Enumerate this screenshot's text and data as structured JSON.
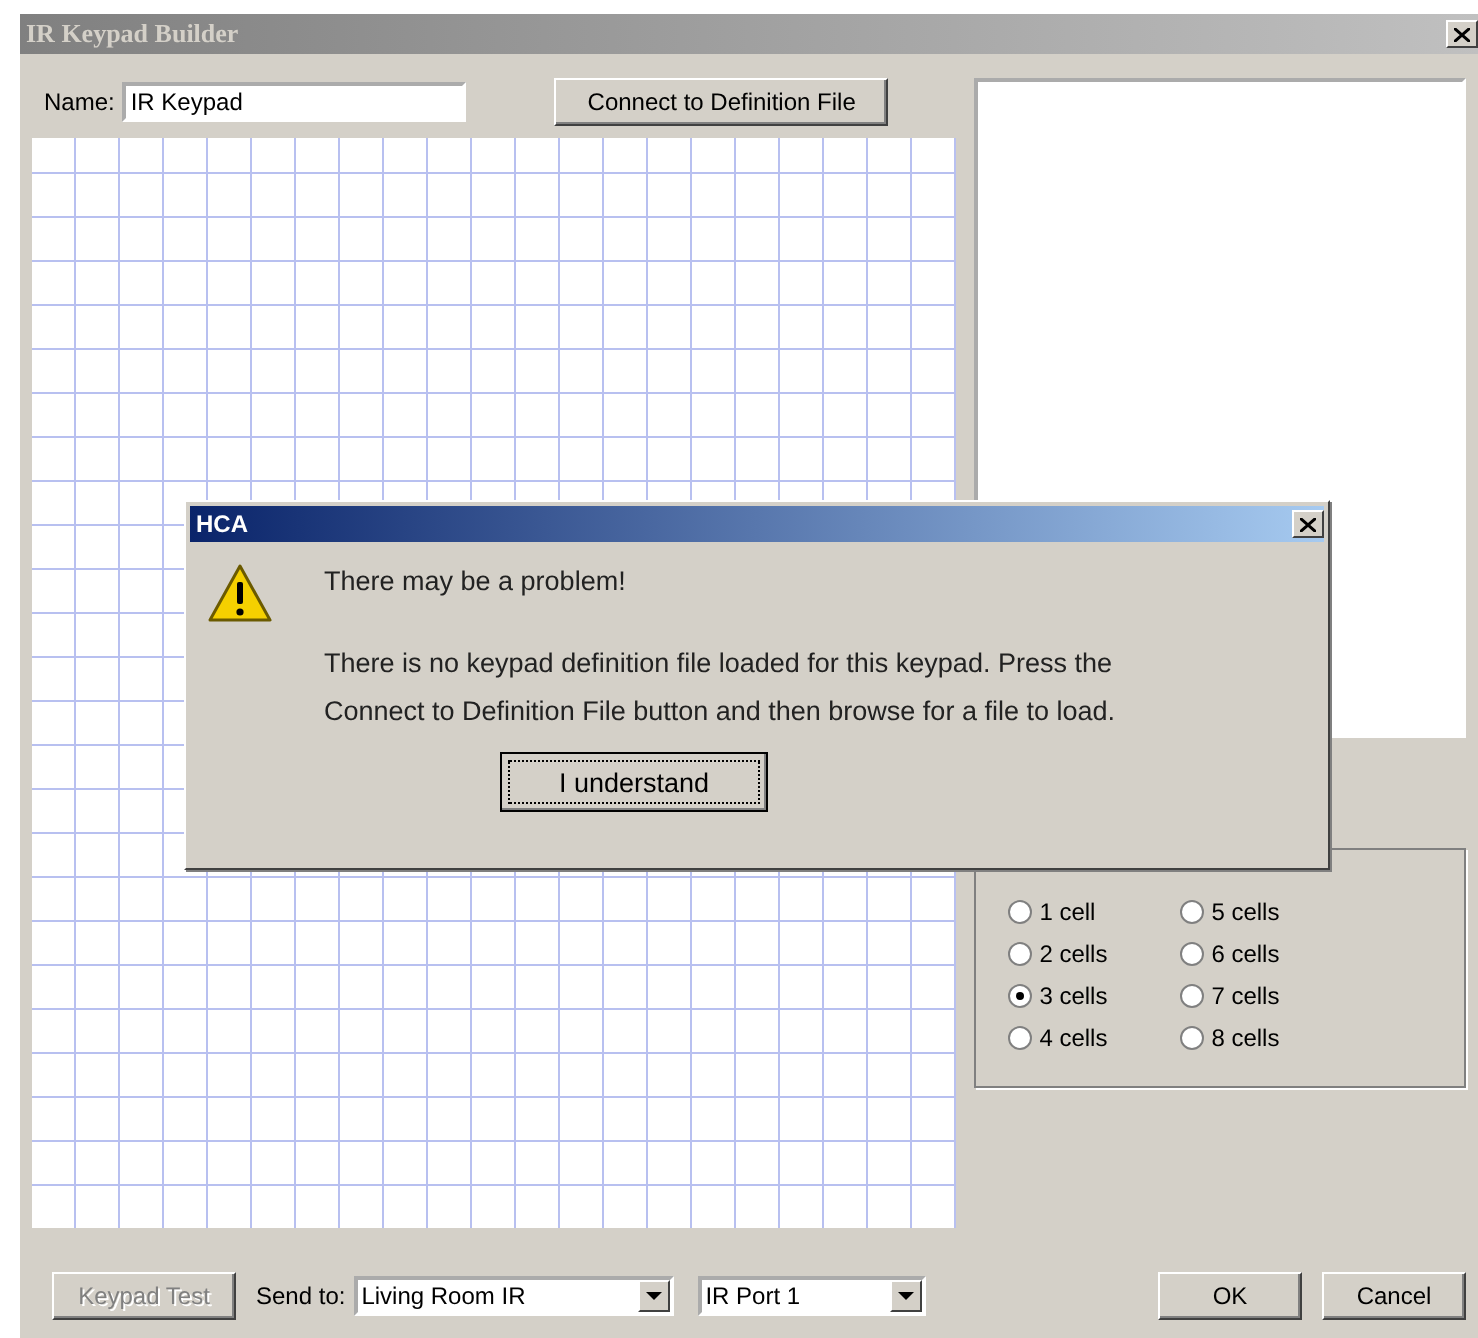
{
  "window": {
    "title": "IR Keypad Builder"
  },
  "name_field": {
    "label": "Name:",
    "value": "IR Keypad"
  },
  "connect_button": {
    "label": "Connect to Definition File"
  },
  "cell_options": [
    {
      "label": "1 cell",
      "selected": false
    },
    {
      "label": "2 cells",
      "selected": false
    },
    {
      "label": "3 cells",
      "selected": true
    },
    {
      "label": "4 cells",
      "selected": false
    },
    {
      "label": "5 cells",
      "selected": false
    },
    {
      "label": "6 cells",
      "selected": false
    },
    {
      "label": "7 cells",
      "selected": false
    },
    {
      "label": "8 cells",
      "selected": false
    }
  ],
  "bottom_bar": {
    "test_button": {
      "label": "Keypad Test",
      "disabled": true
    },
    "send_to_label": "Send to:",
    "target_select": {
      "value": "Living Room IR"
    },
    "port_select": {
      "value": "IR Port 1"
    },
    "ok_button": "OK",
    "cancel_button": "Cancel"
  },
  "dialog": {
    "title": "HCA",
    "heading": "There may be a problem!",
    "message": "There is no keypad definition file loaded for this keypad. Press the Connect to Definition File button and then browse for a file to load.",
    "button": "I understand"
  }
}
